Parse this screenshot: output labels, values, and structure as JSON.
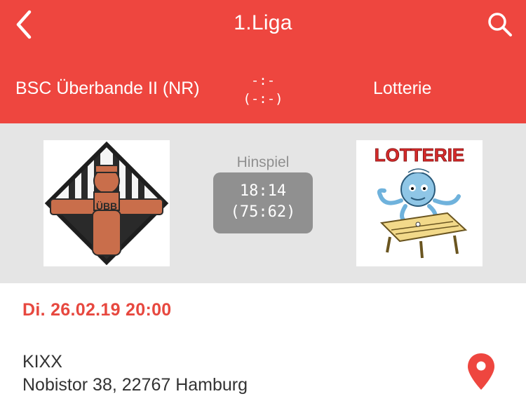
{
  "header": {
    "title": "1.Liga",
    "home_team": "BSC Überbande II (NR)",
    "away_team": "Lotterie",
    "score_line1": "-:-",
    "score_line2": "(-:-)",
    "back_icon": "chevron-left-icon",
    "search_icon": "search-icon"
  },
  "match": {
    "leg": "Hinspiel",
    "score": "18:14",
    "score_detail": "(75:62)",
    "home_logo_text": "ÜBB",
    "away_logo_text": "LOTTERIE"
  },
  "details": {
    "datetime": "Di. 26.02.19 20:00",
    "venue_name": "KIXX",
    "venue_address": "Nobistor 38, 22767 Hamburg",
    "map_icon": "map-pin-icon"
  },
  "colors": {
    "accent": "#ee463f",
    "band": "#e5e5e5",
    "result_box": "#909090"
  }
}
